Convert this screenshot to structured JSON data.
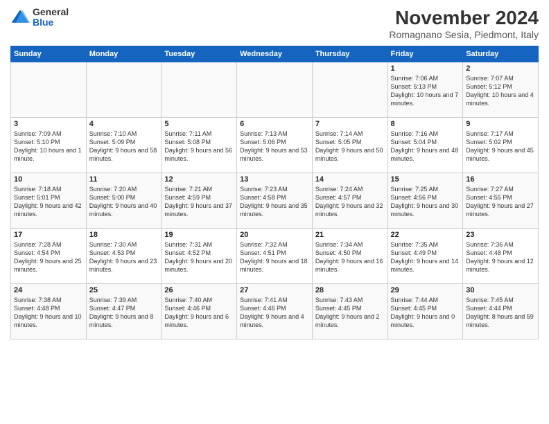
{
  "header": {
    "logo": {
      "general": "General",
      "blue": "Blue"
    },
    "title": "November 2024",
    "subtitle": "Romagnano Sesia, Piedmont, Italy"
  },
  "calendar": {
    "days": [
      "Sunday",
      "Monday",
      "Tuesday",
      "Wednesday",
      "Thursday",
      "Friday",
      "Saturday"
    ],
    "weeks": [
      [
        {
          "day": "",
          "info": ""
        },
        {
          "day": "",
          "info": ""
        },
        {
          "day": "",
          "info": ""
        },
        {
          "day": "",
          "info": ""
        },
        {
          "day": "",
          "info": ""
        },
        {
          "day": "1",
          "info": "Sunrise: 7:06 AM\nSunset: 5:13 PM\nDaylight: 10 hours and 7 minutes."
        },
        {
          "day": "2",
          "info": "Sunrise: 7:07 AM\nSunset: 5:12 PM\nDaylight: 10 hours and 4 minutes."
        }
      ],
      [
        {
          "day": "3",
          "info": "Sunrise: 7:09 AM\nSunset: 5:10 PM\nDaylight: 10 hours and 1 minute."
        },
        {
          "day": "4",
          "info": "Sunrise: 7:10 AM\nSunset: 5:09 PM\nDaylight: 9 hours and 58 minutes."
        },
        {
          "day": "5",
          "info": "Sunrise: 7:11 AM\nSunset: 5:08 PM\nDaylight: 9 hours and 56 minutes."
        },
        {
          "day": "6",
          "info": "Sunrise: 7:13 AM\nSunset: 5:06 PM\nDaylight: 9 hours and 53 minutes."
        },
        {
          "day": "7",
          "info": "Sunrise: 7:14 AM\nSunset: 5:05 PM\nDaylight: 9 hours and 50 minutes."
        },
        {
          "day": "8",
          "info": "Sunrise: 7:16 AM\nSunset: 5:04 PM\nDaylight: 9 hours and 48 minutes."
        },
        {
          "day": "9",
          "info": "Sunrise: 7:17 AM\nSunset: 5:02 PM\nDaylight: 9 hours and 45 minutes."
        }
      ],
      [
        {
          "day": "10",
          "info": "Sunrise: 7:18 AM\nSunset: 5:01 PM\nDaylight: 9 hours and 42 minutes."
        },
        {
          "day": "11",
          "info": "Sunrise: 7:20 AM\nSunset: 5:00 PM\nDaylight: 9 hours and 40 minutes."
        },
        {
          "day": "12",
          "info": "Sunrise: 7:21 AM\nSunset: 4:59 PM\nDaylight: 9 hours and 37 minutes."
        },
        {
          "day": "13",
          "info": "Sunrise: 7:23 AM\nSunset: 4:58 PM\nDaylight: 9 hours and 35 minutes."
        },
        {
          "day": "14",
          "info": "Sunrise: 7:24 AM\nSunset: 4:57 PM\nDaylight: 9 hours and 32 minutes."
        },
        {
          "day": "15",
          "info": "Sunrise: 7:25 AM\nSunset: 4:56 PM\nDaylight: 9 hours and 30 minutes."
        },
        {
          "day": "16",
          "info": "Sunrise: 7:27 AM\nSunset: 4:55 PM\nDaylight: 9 hours and 27 minutes."
        }
      ],
      [
        {
          "day": "17",
          "info": "Sunrise: 7:28 AM\nSunset: 4:54 PM\nDaylight: 9 hours and 25 minutes."
        },
        {
          "day": "18",
          "info": "Sunrise: 7:30 AM\nSunset: 4:53 PM\nDaylight: 9 hours and 23 minutes."
        },
        {
          "day": "19",
          "info": "Sunrise: 7:31 AM\nSunset: 4:52 PM\nDaylight: 9 hours and 20 minutes."
        },
        {
          "day": "20",
          "info": "Sunrise: 7:32 AM\nSunset: 4:51 PM\nDaylight: 9 hours and 18 minutes."
        },
        {
          "day": "21",
          "info": "Sunrise: 7:34 AM\nSunset: 4:50 PM\nDaylight: 9 hours and 16 minutes."
        },
        {
          "day": "22",
          "info": "Sunrise: 7:35 AM\nSunset: 4:49 PM\nDaylight: 9 hours and 14 minutes."
        },
        {
          "day": "23",
          "info": "Sunrise: 7:36 AM\nSunset: 4:48 PM\nDaylight: 9 hours and 12 minutes."
        }
      ],
      [
        {
          "day": "24",
          "info": "Sunrise: 7:38 AM\nSunset: 4:48 PM\nDaylight: 9 hours and 10 minutes."
        },
        {
          "day": "25",
          "info": "Sunrise: 7:39 AM\nSunset: 4:47 PM\nDaylight: 9 hours and 8 minutes."
        },
        {
          "day": "26",
          "info": "Sunrise: 7:40 AM\nSunset: 4:46 PM\nDaylight: 9 hours and 6 minutes."
        },
        {
          "day": "27",
          "info": "Sunrise: 7:41 AM\nSunset: 4:46 PM\nDaylight: 9 hours and 4 minutes."
        },
        {
          "day": "28",
          "info": "Sunrise: 7:43 AM\nSunset: 4:45 PM\nDaylight: 9 hours and 2 minutes."
        },
        {
          "day": "29",
          "info": "Sunrise: 7:44 AM\nSunset: 4:45 PM\nDaylight: 9 hours and 0 minutes."
        },
        {
          "day": "30",
          "info": "Sunrise: 7:45 AM\nSunset: 4:44 PM\nDaylight: 8 hours and 59 minutes."
        }
      ]
    ]
  }
}
